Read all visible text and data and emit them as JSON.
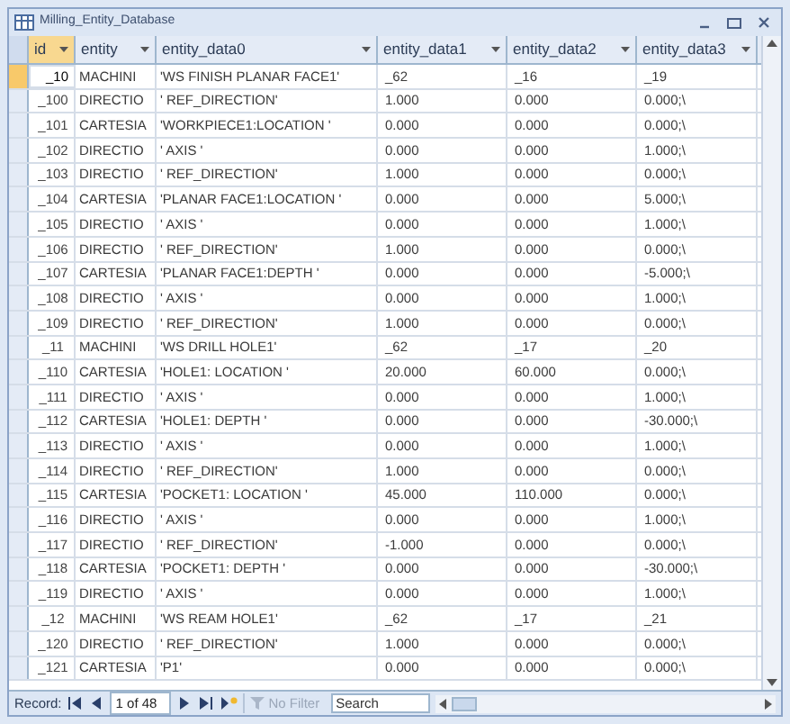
{
  "window": {
    "title": "Milling_Entity_Database"
  },
  "table": {
    "columns": [
      "id",
      "entity",
      "entity_data0",
      "entity_data1",
      "entity_data2",
      "entity_data3"
    ],
    "rows": [
      {
        "cells": [
          "_10",
          "MACHINI",
          "'WS FINISH PLANAR FACE1'",
          "_62",
          "_16",
          "_19"
        ],
        "selected": true
      },
      {
        "cells": [
          "_100",
          "DIRECTIO",
          "' REF_DIRECTION'",
          "1.000",
          "0.000",
          "0.000;\\"
        ],
        "selected": false
      },
      {
        "cells": [
          "_101",
          "CARTESIA",
          "'WORKPIECE1:LOCATION '",
          "0.000",
          "0.000",
          "0.000;\\"
        ],
        "selected": false
      },
      {
        "cells": [
          "_102",
          "DIRECTIO",
          "' AXIS '",
          "0.000",
          "0.000",
          "1.000;\\"
        ],
        "selected": false
      },
      {
        "cells": [
          "_103",
          "DIRECTIO",
          "' REF_DIRECTION'",
          "1.000",
          "0.000",
          "0.000;\\"
        ],
        "selected": false
      },
      {
        "cells": [
          "_104",
          "CARTESIA",
          "'PLANAR FACE1:LOCATION '",
          "0.000",
          "0.000",
          "5.000;\\"
        ],
        "selected": false
      },
      {
        "cells": [
          "_105",
          "DIRECTIO",
          "' AXIS '",
          "0.000",
          "0.000",
          "1.000;\\"
        ],
        "selected": false
      },
      {
        "cells": [
          "_106",
          "DIRECTIO",
          "' REF_DIRECTION'",
          "1.000",
          "0.000",
          "0.000;\\"
        ],
        "selected": false
      },
      {
        "cells": [
          "_107",
          "CARTESIA",
          "'PLANAR FACE1:DEPTH '",
          "0.000",
          "0.000",
          "-5.000;\\"
        ],
        "selected": false
      },
      {
        "cells": [
          "_108",
          "DIRECTIO",
          "' AXIS '",
          "0.000",
          "0.000",
          "1.000;\\"
        ],
        "selected": false
      },
      {
        "cells": [
          "_109",
          "DIRECTIO",
          "' REF_DIRECTION'",
          "1.000",
          "0.000",
          "0.000;\\"
        ],
        "selected": false
      },
      {
        "cells": [
          "_11",
          "MACHINI",
          "'WS DRILL HOLE1'",
          "_62",
          "_17",
          "_20"
        ],
        "selected": false
      },
      {
        "cells": [
          "_110",
          "CARTESIA",
          "'HOLE1: LOCATION '",
          "20.000",
          "60.000",
          "0.000;\\"
        ],
        "selected": false
      },
      {
        "cells": [
          "_111",
          "DIRECTIO",
          "' AXIS '",
          "0.000",
          "0.000",
          "1.000;\\"
        ],
        "selected": false
      },
      {
        "cells": [
          "_112",
          "CARTESIA",
          "'HOLE1: DEPTH '",
          "0.000",
          "0.000",
          "-30.000;\\"
        ],
        "selected": false
      },
      {
        "cells": [
          "_113",
          "DIRECTIO",
          "' AXIS '",
          "0.000",
          "0.000",
          "1.000;\\"
        ],
        "selected": false
      },
      {
        "cells": [
          "_114",
          "DIRECTIO",
          "' REF_DIRECTION'",
          "1.000",
          "0.000",
          "0.000;\\"
        ],
        "selected": false
      },
      {
        "cells": [
          "_115",
          "CARTESIA",
          "'POCKET1: LOCATION '",
          "45.000",
          "110.000",
          "0.000;\\"
        ],
        "selected": false
      },
      {
        "cells": [
          "_116",
          "DIRECTIO",
          "' AXIS '",
          "0.000",
          "0.000",
          "1.000;\\"
        ],
        "selected": false
      },
      {
        "cells": [
          "_117",
          "DIRECTIO",
          "' REF_DIRECTION'",
          "-1.000",
          "0.000",
          "0.000;\\"
        ],
        "selected": false
      },
      {
        "cells": [
          "_118",
          "CARTESIA",
          "'POCKET1: DEPTH '",
          "0.000",
          "0.000",
          "-30.000;\\"
        ],
        "selected": false
      },
      {
        "cells": [
          "_119",
          "DIRECTIO",
          "' AXIS '",
          "0.000",
          "0.000",
          "1.000;\\"
        ],
        "selected": false
      },
      {
        "cells": [
          "_12",
          "MACHINI",
          "'WS REAM HOLE1'",
          "_62",
          "_17",
          "_21"
        ],
        "selected": false
      },
      {
        "cells": [
          "_120",
          "DIRECTIO",
          "' REF_DIRECTION'",
          "1.000",
          "0.000",
          "0.000;\\"
        ],
        "selected": false
      },
      {
        "cells": [
          "_121",
          "CARTESIA",
          "'P1'",
          "0.000",
          "0.000",
          "0.000;\\"
        ],
        "selected": false
      }
    ]
  },
  "record_bar": {
    "label": "Record:",
    "position": "1 of 48",
    "filter": {
      "label": "No Filter",
      "disabled": true
    },
    "search": {
      "placeholder": "Search"
    }
  }
}
